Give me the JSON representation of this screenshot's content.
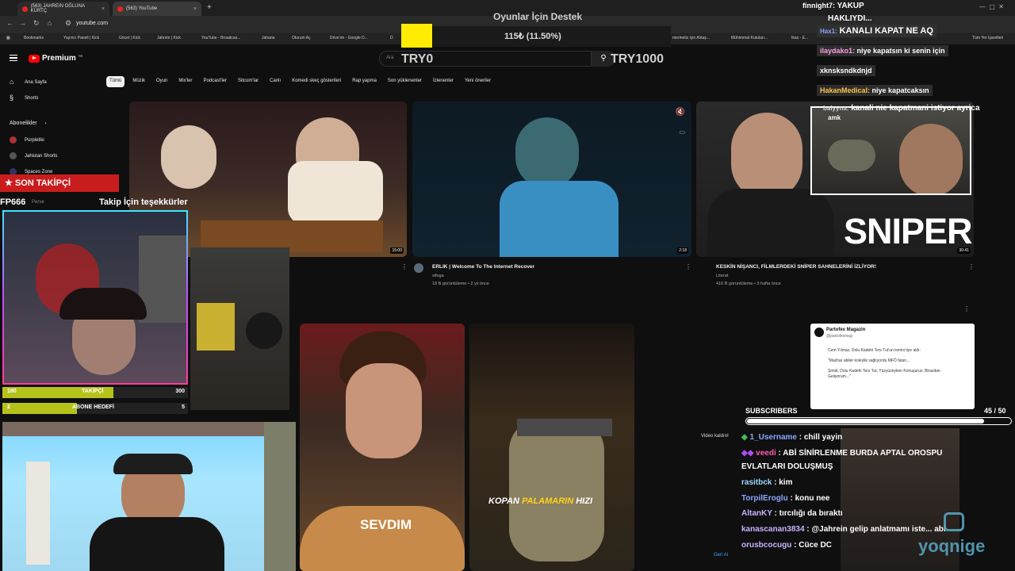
{
  "browser": {
    "tabs": [
      {
        "label": "(563) JAHREIN OĞLUNA KÜRTÇ",
        "close": "×"
      },
      {
        "label": "(563) YouTube",
        "close": "×"
      }
    ],
    "new_tab": "+",
    "url": "youtube.com",
    "bookmarks": [
      "Bookmarks",
      "Yayıncı Paneli | Kick",
      "Göcet | Kick",
      "Jahrein | Kick",
      "YouTube - Broadcas...",
      "Jaharia",
      "Oturum Aç",
      "Drive'ım - Google D...",
      "D",
      "merinetiz için Alıtaş...",
      "Mühimmat Kutuları...",
      "Ikas - E...",
      "Tüm Yer İşaretleri"
    ]
  },
  "youtube": {
    "logo": "Premium",
    "logo_badge": "TR",
    "search_placeholder": "Ara",
    "sidebar": [
      {
        "label": "Ana Sayfa"
      },
      {
        "label": "Shorts"
      },
      {
        "label": "Abonelikler"
      },
      {
        "label": "Purpletiki"
      },
      {
        "label": "Jahistan Shorts"
      },
      {
        "label": "Spaces Zone"
      },
      {
        "label": "Perse"
      }
    ],
    "chips": [
      "Tümü",
      "Müzik",
      "Oyun",
      "Mix'ler",
      "Podcast'ler",
      "Sitcom'lar",
      "Canlı",
      "Komedi skeç gösterileri",
      "Rap yapma",
      "Son yüklenenler",
      "İzlenenler",
      "Yeni öneriler"
    ],
    "videos": [
      {
        "duration": "15:00"
      },
      {
        "title": "ERLIK | Welcome To The Internet Recover",
        "channel": "sifega",
        "meta": "18 B görüntüleme • 2 yıl önce",
        "duration": "2:18"
      },
      {
        "title": "KESKİN NİŞANCI, FİLMLERDEKİ SNİPER SAHNELERİNİ İZLİYOR!",
        "channel": "Literat",
        "meta": "416 B görüntüleme • 3 hafta önce",
        "duration": "30:41"
      }
    ],
    "shorts": [
      {
        "caption": "SEVDIM"
      },
      {
        "caption_a": "KOPAN",
        "caption_b": "PALAMARIN",
        "caption_c": "HIZI"
      }
    ],
    "video_removed": "Video kaldırıl",
    "undo": "Geri Al"
  },
  "overlay": {
    "goal_title": "Oyunlar İçin Destek",
    "goal_value": "115₺ (11.50%)",
    "goal_percent": 11.5,
    "goal_min": "TRY0",
    "goal_max": "TRY1000",
    "son_takipci_label": "SON TAKİPÇİ",
    "son_takipci_user": "FP666",
    "son_takipci_thanks": "Takip İçin teşekkürler",
    "takipci": {
      "current": "180",
      "label": "TAKİPÇİ",
      "target": "300",
      "fraction": 0.6
    },
    "abone": {
      "current": "2",
      "label": "ABONE HEDEFİ",
      "target": "5",
      "fraction": 0.4
    },
    "sniper_text": "SNIPER",
    "subs": {
      "label": "SUBSCRIBERS",
      "count": "45 / 50",
      "fraction": 0.9
    },
    "tweet": {
      "name": "Partofex Magazin",
      "handle": "@partofexmag",
      "lines": [
        "Cem Yılmaz, Dolu Kadehi Ters Tut'un ismini tiye aldı:",
        "\"Mazhar abiler koleylik sağlıyordu MFÖ falan...",
        "Şimdi, Dolu Kadehi Ters Tut, Yüzyüzeyken Konuşuruz, Birazdan Geliyorum...\""
      ]
    },
    "watermark": "yoqnige"
  },
  "chat_top": [
    {
      "user": "finnight7:",
      "msg": "YAKUP",
      "color": "#ffffff"
    },
    {
      "user": "",
      "msg": "HAKLIYDI...",
      "color": "#ffffff"
    },
    {
      "user": "Hax1:",
      "msg": "KANALI KAPAT NE AQ",
      "color": "#8aa6ff"
    },
    {
      "user": "ilaydako1:",
      "msg": "niye kapatsın ki senin için",
      "color": "#ff9ee0"
    },
    {
      "user": "",
      "msg": "xknsksndkdnjd",
      "color": "#ffffff"
    },
    {
      "user": "HakanMedical:",
      "msg": "niye kapatcaksın",
      "color": "#ffc44a"
    },
    {
      "user": "balyyna:",
      "msg": "kanali nie kapatmani istiyor ayrica",
      "color": "#d9d9d9"
    },
    {
      "user": "",
      "msg": "amk",
      "color": "#ffffff"
    }
  ],
  "chat_bottom": [
    {
      "user": "1_Username",
      "msg": ": chill yayin",
      "color": "#8aa6ff"
    },
    {
      "user": "veedi",
      "msg": ": ABİ SİNİRLENME BURDA APTAL OROSPU",
      "color": "#ff5ab4"
    },
    {
      "user": "",
      "msg": "EVLATLARI DOLUŞMUŞ",
      "color": "#ffffff"
    },
    {
      "user": "rasitbck",
      "msg": ": kim",
      "color": "#9ad7ff"
    },
    {
      "user": "TorpilEroglu",
      "msg": ": konu nee",
      "color": "#8aa6ff"
    },
    {
      "user": "AltanKY",
      "msg": ": tırcılığı da bıraktı",
      "color": "#c9b2ff"
    },
    {
      "user": "kanascanan3834",
      "msg": ": @Jahrein gelip anlatmamı iste...  abi",
      "color": "#c9b2ff"
    },
    {
      "user": "orusbcocugu",
      "msg": ": Cüce DC",
      "color": "#c9b2ff"
    }
  ],
  "colors": {
    "accent_red": "#c91d1d",
    "goal_yellow": "#ffec00",
    "bar_green": "#b5c21a",
    "yt_red": "#ff0000"
  }
}
